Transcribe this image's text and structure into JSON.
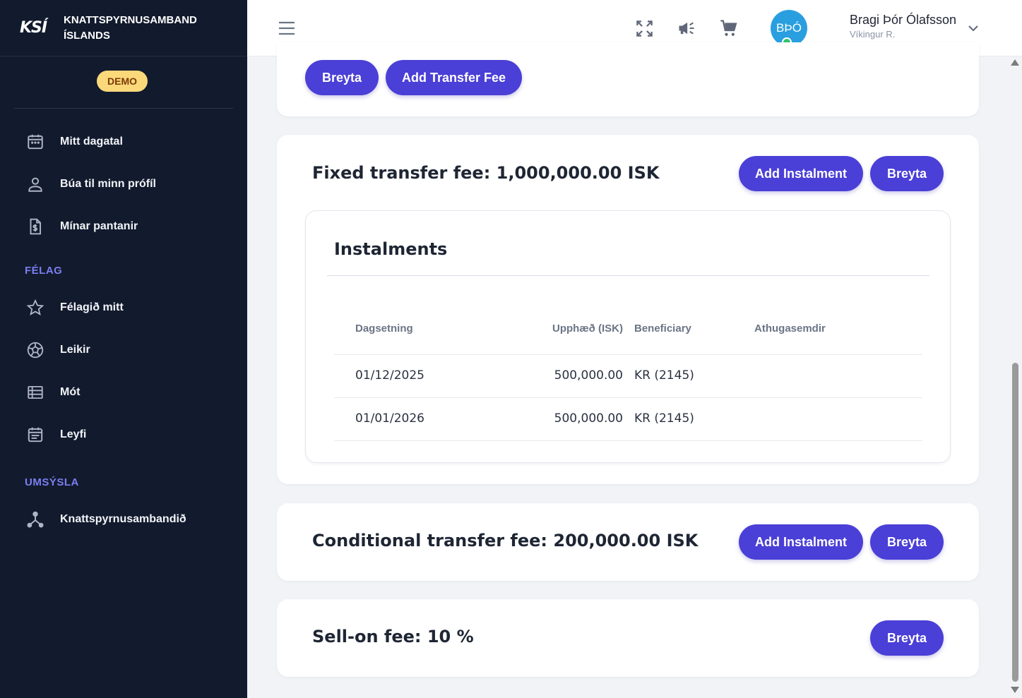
{
  "brand": {
    "logo": "KSÍ",
    "name_line1": "KNATTSPYRNUSAMBAND",
    "name_line2": "ÍSLANDS",
    "badge": "DEMO"
  },
  "sidebar": {
    "items": [
      {
        "label": "Mitt dagatal",
        "icon": "calendar-icon"
      },
      {
        "label": "Búa til minn prófíl",
        "icon": "person-icon"
      },
      {
        "label": "Mínar pantanir",
        "icon": "invoice-icon"
      }
    ],
    "section_club": "FÉLAG",
    "club_items": [
      {
        "label": "Félagið mitt",
        "icon": "star-icon"
      },
      {
        "label": "Leikir",
        "icon": "soccer-ball-icon"
      },
      {
        "label": "Mót",
        "icon": "list-icon"
      },
      {
        "label": "Leyfi",
        "icon": "event-note-icon"
      }
    ],
    "section_admin": "UMSÝSLA",
    "admin_items": [
      {
        "label": "Knattspyrnusambandið",
        "icon": "hub-icon"
      }
    ]
  },
  "header": {
    "avatar_initials": "BÞÓ",
    "user_name": "Bragi Þór Ólafsson",
    "user_club": "Víkingur R."
  },
  "top_card": {
    "edit_label": "Breyta",
    "add_transfer_fee_label": "Add Transfer Fee"
  },
  "fixed_fee": {
    "title": "Fixed transfer fee: 1,000,000.00 ISK",
    "add_instalment_label": "Add Instalment",
    "edit_label": "Breyta",
    "instalments": {
      "title": "Instalments",
      "columns": [
        "Dagsetning",
        "Upphæð (ISK)",
        "Beneficiary",
        "Athugasemdir"
      ],
      "rows": [
        {
          "date": "01/12/2025",
          "amount": "500,000.00",
          "beneficiary": "KR (2145)",
          "notes": ""
        },
        {
          "date": "01/01/2026",
          "amount": "500,000.00",
          "beneficiary": "KR (2145)",
          "notes": ""
        }
      ]
    }
  },
  "conditional_fee": {
    "title": "Conditional transfer fee: 200,000.00 ISK",
    "add_instalment_label": "Add Instalment",
    "edit_label": "Breyta"
  },
  "sell_on_fee": {
    "title": "Sell-on fee: 10 %",
    "edit_label": "Breyta"
  },
  "colors": {
    "sidebar_bg": "#121a2d",
    "accent": "#4a3fd6",
    "section_label": "#7b7ff0",
    "badge_bg": "#fbd97b",
    "avatar_bg": "#2a9fe0",
    "online_dot": "#32c36b"
  }
}
